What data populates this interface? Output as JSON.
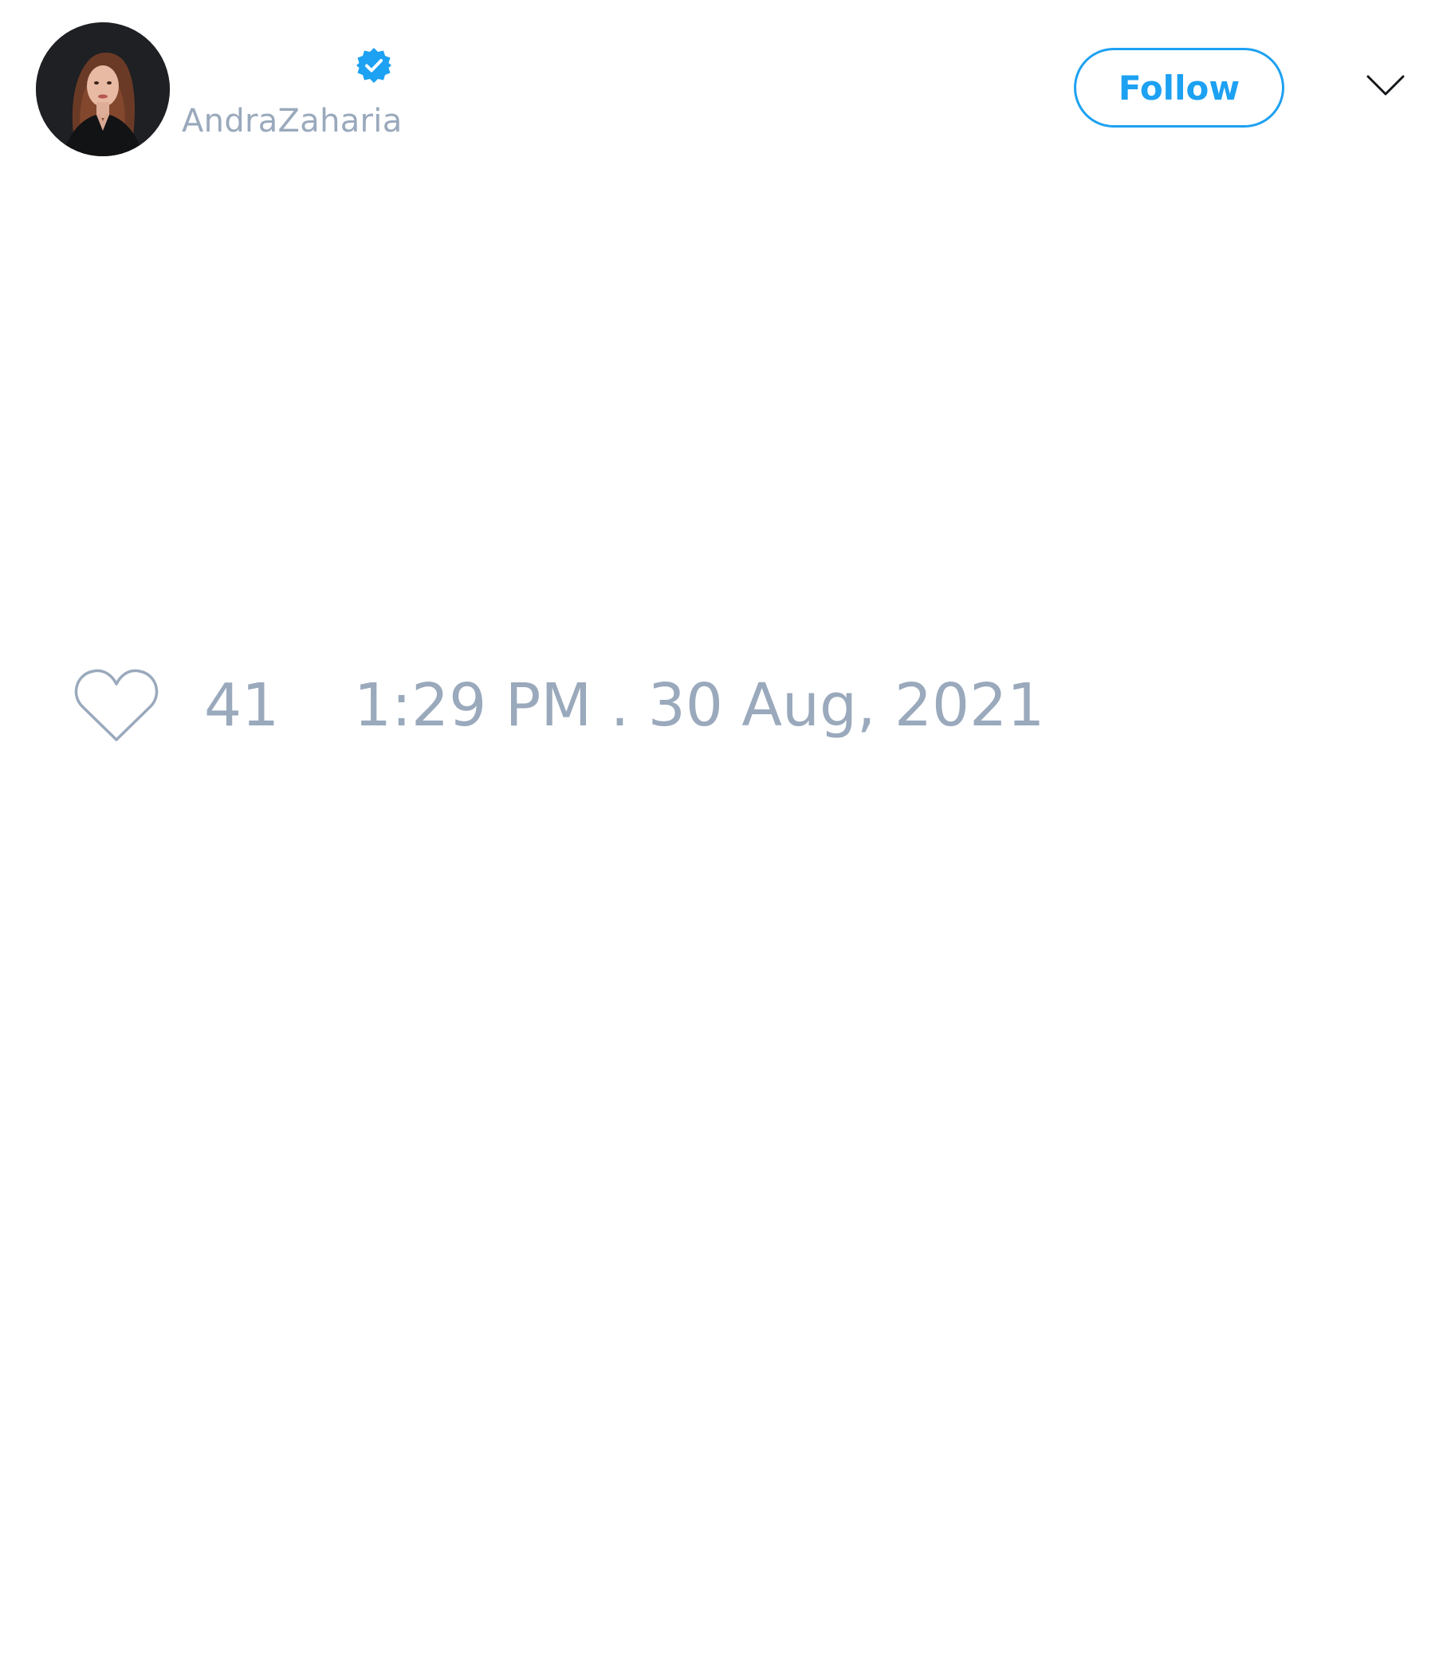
{
  "tweet": {
    "author": {
      "display_name": "",
      "handle": "AndraZaharia",
      "verified": true
    },
    "follow_label": "Follow",
    "likes": "41",
    "timestamp": "1:29 PM . 30 Aug, 2021"
  },
  "icons": {
    "verified": "verified-badge-icon",
    "menu": "chevron-down-icon",
    "like": "heart-icon"
  },
  "colors": {
    "accent": "#1da1f2",
    "muted_text": "#9aa9bc",
    "background": "#ffffff"
  }
}
